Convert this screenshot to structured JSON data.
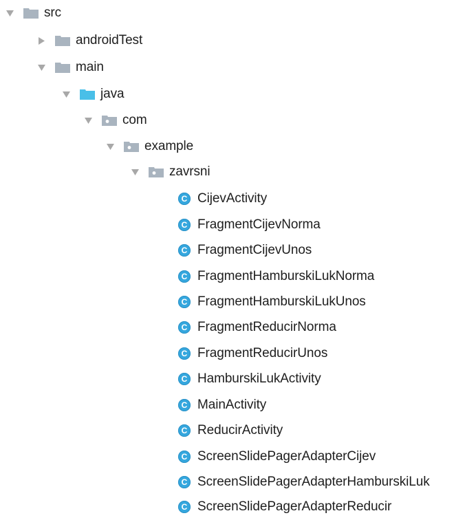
{
  "tree": {
    "src": {
      "label": "src",
      "expanded": true
    },
    "androidTest": {
      "label": "androidTest",
      "expanded": false
    },
    "main": {
      "label": "main",
      "expanded": true
    },
    "java": {
      "label": "java",
      "expanded": true
    },
    "com": {
      "label": "com",
      "expanded": true
    },
    "example": {
      "label": "example",
      "expanded": true
    },
    "zavrsni": {
      "label": "zavrsni",
      "expanded": true
    },
    "class_icon_letter": "C",
    "classes": [
      "CijevActivity",
      "FragmentCijevNorma",
      "FragmentCijevUnos",
      "FragmentHamburskiLukNorma",
      "FragmentHamburskiLukUnos",
      "FragmentReducirNorma",
      "FragmentReducirUnos",
      "HamburskiLukActivity",
      "MainActivity",
      "ReducirActivity",
      "ScreenSlidePagerAdapterCijev",
      "ScreenSlidePagerAdapterHamburskiLuk",
      "ScreenSlidePagerAdapterReducir"
    ]
  },
  "colors": {
    "folder_gray": "#a9b4bf",
    "folder_blue": "#49bfe8",
    "package_gray": "#a9b4bf",
    "class_icon": "#35a7de",
    "arrow": "#a8a8a8"
  }
}
